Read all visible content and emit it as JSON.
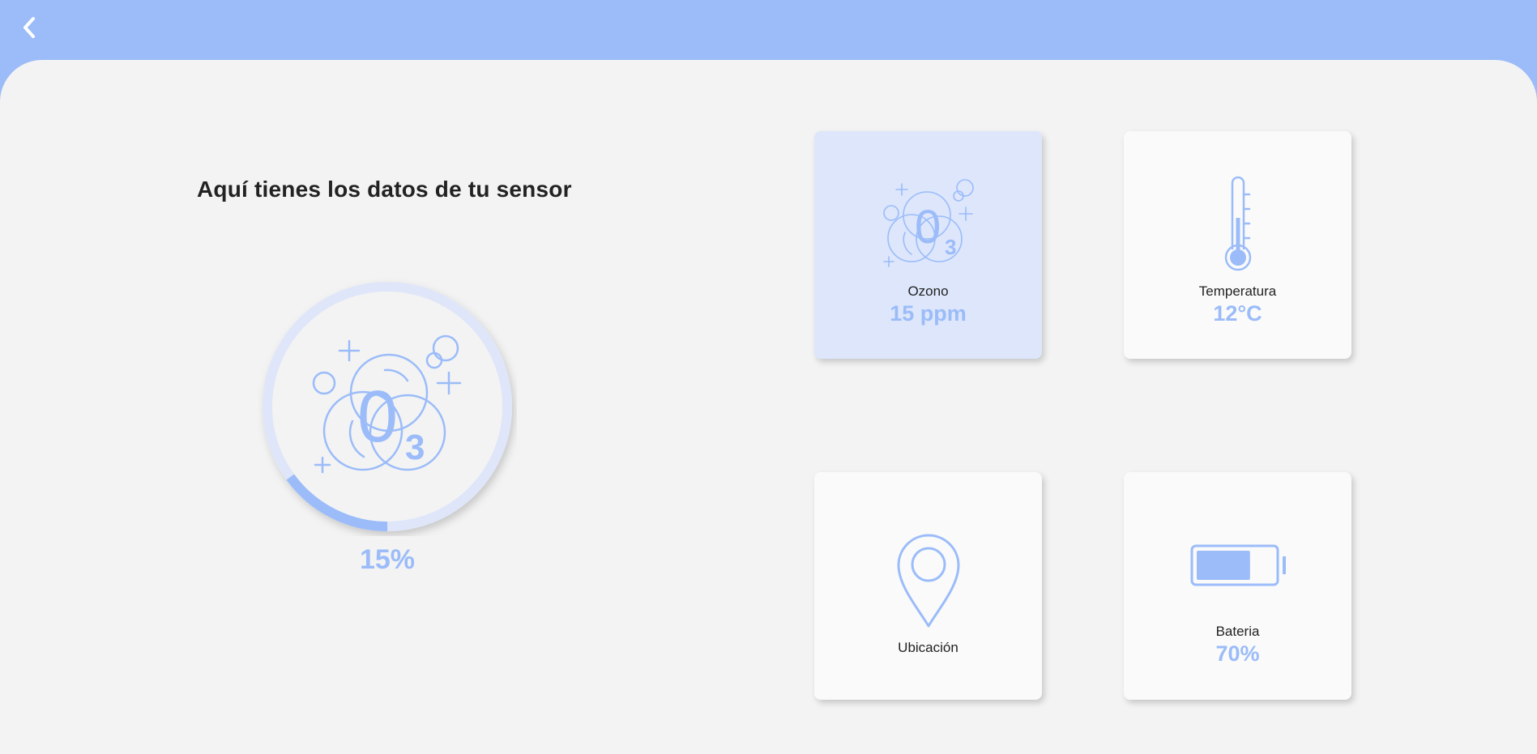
{
  "header": {
    "back_icon": "chevron-left-icon"
  },
  "main": {
    "headline": "Aquí tienes los datos de tu sensor",
    "gauge": {
      "label": "15%",
      "fraction": 0.15,
      "icon": "ozone-icon",
      "progress_color": "#9bbcf9",
      "track_color": "#dfe6f9"
    }
  },
  "cards": [
    {
      "id": "ozono",
      "label": "Ozono",
      "value": "15 ppm",
      "icon": "ozone-icon",
      "selected": true
    },
    {
      "id": "temperatura",
      "label": "Temperatura",
      "value": "12°C",
      "icon": "thermometer-icon",
      "selected": false
    },
    {
      "id": "ubicacion",
      "label": "Ubicación",
      "icon": "location-pin-icon",
      "selected": false
    },
    {
      "id": "bateria",
      "label": "Bateria",
      "value": "70%",
      "icon": "battery-icon",
      "selected": false,
      "level": 0.7
    }
  ],
  "colors": {
    "accent": "#9bbcf9",
    "header": "#9bbcf9",
    "background": "#f3f3f3",
    "selected_card": "#dde6fb"
  }
}
